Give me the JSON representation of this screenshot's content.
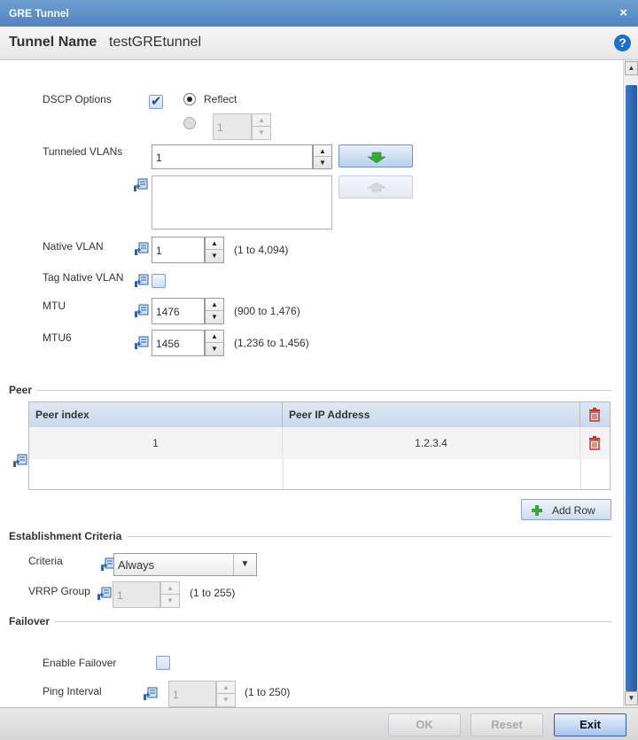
{
  "window": {
    "title": "GRE Tunnel",
    "close_glyph": "×"
  },
  "header": {
    "name_label": "Tunnel Name",
    "name_value": "testGREtunnel",
    "help_glyph": "?"
  },
  "dscp": {
    "label": "DSCP Options",
    "checked": true,
    "reflect_label": "Reflect",
    "value_placeholder": "1"
  },
  "tunneled_vlans": {
    "label": "Tunneled VLANs",
    "value": "1"
  },
  "native_vlan": {
    "label": "Native VLAN",
    "value": "1",
    "range": "(1 to 4,094)"
  },
  "tag_native_vlan": {
    "label": "Tag Native VLAN",
    "checked": false
  },
  "mtu": {
    "label": "MTU",
    "value": "1476",
    "range": "(900 to 1,476)"
  },
  "mtu6": {
    "label": "MTU6",
    "value": "1456",
    "range": "(1,236 to 1,456)"
  },
  "peer": {
    "section_title": "Peer",
    "columns": [
      "Peer index",
      "Peer IP Address"
    ],
    "rows": [
      {
        "index": "1",
        "ip": "1.2.3.4"
      }
    ],
    "add_row_label": "Add Row"
  },
  "establishment": {
    "section_title": "Establishment Criteria",
    "criteria_label": "Criteria",
    "criteria_value": "Always",
    "vrrp_label": "VRRP Group",
    "vrrp_value": "1",
    "vrrp_range": "(1 to 255)"
  },
  "failover": {
    "section_title": "Failover",
    "enable_label": "Enable Failover",
    "enabled": false,
    "ping_label": "Ping Interval",
    "ping_value": "1",
    "ping_range": "(1 to 250)"
  },
  "footer": {
    "ok_label": "OK",
    "reset_label": "Reset",
    "exit_label": "Exit"
  },
  "colors": {
    "title_bar": "#4f83c0",
    "accent": "#1a6fd4",
    "trash": "#c0392b",
    "add_green": "#3aa835"
  }
}
